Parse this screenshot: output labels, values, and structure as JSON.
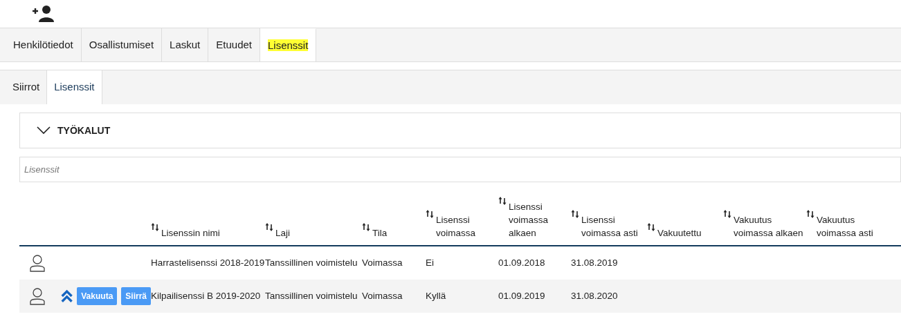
{
  "tabs": [
    {
      "label": "Henkilötiedot",
      "selected": false,
      "highlighted": false
    },
    {
      "label": "Osallistumiset",
      "selected": false,
      "highlighted": false
    },
    {
      "label": "Laskut",
      "selected": false,
      "highlighted": false
    },
    {
      "label": "Etuudet",
      "selected": false,
      "highlighted": false
    },
    {
      "label": "Lisenssit",
      "selected": true,
      "highlighted": true
    }
  ],
  "subtabs": [
    {
      "label": "Siirrot",
      "selected": false
    },
    {
      "label": "Lisenssit",
      "selected": true
    }
  ],
  "tools": {
    "label": "TYÖKALUT",
    "expanded": false
  },
  "search": {
    "placeholder": "Lisenssit"
  },
  "table": {
    "columns": [
      "Lisenssin nimi",
      "Laji",
      "Tila",
      "Lisenssi voimassa",
      "Lisenssi voimassa alkaen",
      "Lisenssi voimassa asti",
      "Vakuutettu",
      "Vakuutus voimassa alkaen",
      "Vakuutus voimassa asti"
    ],
    "rows": [
      {
        "highlighted": false,
        "promoted": false,
        "buttons": [],
        "cells": [
          "Harrastelisenssi 2018-2019",
          "Tanssillinen voimistelu",
          "Voimassa",
          "Ei",
          "01.09.2018",
          "31.08.2019"
        ]
      },
      {
        "highlighted": true,
        "promoted": true,
        "buttons": [
          "Vakuuta",
          "Siirrä"
        ],
        "cells": [
          "Kilpailisenssi B 2019-2020",
          "Tanssillinen voimistelu",
          "Voimassa",
          "Kyllä",
          "01.09.2019",
          "31.08.2020"
        ]
      }
    ]
  }
}
